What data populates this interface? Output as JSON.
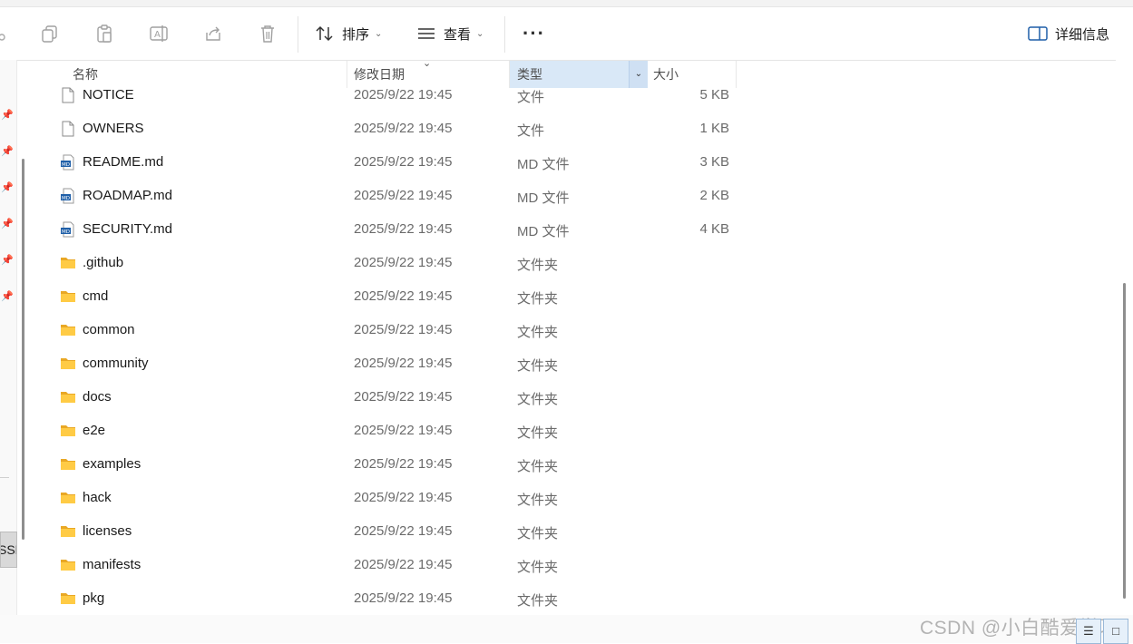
{
  "toolbar": {
    "sort_label": "排序",
    "view_label": "查看",
    "details_label": "详细信息",
    "icons": [
      "copy-icon",
      "paste-icon",
      "rename-icon",
      "share-icon",
      "delete-icon"
    ]
  },
  "columns": {
    "name": "名称",
    "date": "修改日期",
    "type": "类型",
    "size": "大小"
  },
  "left_tab": "SSD",
  "files": [
    {
      "name": "NOTICE",
      "date": "2025/9/22 19:45",
      "type": "文件",
      "size": "5 KB",
      "icon": "file-icon"
    },
    {
      "name": "OWNERS",
      "date": "2025/9/22 19:45",
      "type": "文件",
      "size": "1 KB",
      "icon": "file-icon"
    },
    {
      "name": "README.md",
      "date": "2025/9/22 19:45",
      "type": "MD 文件",
      "size": "3 KB",
      "icon": "md-file-icon"
    },
    {
      "name": "ROADMAP.md",
      "date": "2025/9/22 19:45",
      "type": "MD 文件",
      "size": "2 KB",
      "icon": "md-file-icon"
    },
    {
      "name": "SECURITY.md",
      "date": "2025/9/22 19:45",
      "type": "MD 文件",
      "size": "4 KB",
      "icon": "md-file-icon"
    },
    {
      "name": ".github",
      "date": "2025/9/22 19:45",
      "type": "文件夹",
      "size": "",
      "icon": "folder-icon"
    },
    {
      "name": "cmd",
      "date": "2025/9/22 19:45",
      "type": "文件夹",
      "size": "",
      "icon": "folder-icon"
    },
    {
      "name": "common",
      "date": "2025/9/22 19:45",
      "type": "文件夹",
      "size": "",
      "icon": "folder-icon"
    },
    {
      "name": "community",
      "date": "2025/9/22 19:45",
      "type": "文件夹",
      "size": "",
      "icon": "folder-icon"
    },
    {
      "name": "docs",
      "date": "2025/9/22 19:45",
      "type": "文件夹",
      "size": "",
      "icon": "folder-icon"
    },
    {
      "name": "e2e",
      "date": "2025/9/22 19:45",
      "type": "文件夹",
      "size": "",
      "icon": "folder-icon"
    },
    {
      "name": "examples",
      "date": "2025/9/22 19:45",
      "type": "文件夹",
      "size": "",
      "icon": "folder-icon"
    },
    {
      "name": "hack",
      "date": "2025/9/22 19:45",
      "type": "文件夹",
      "size": "",
      "icon": "folder-icon"
    },
    {
      "name": "licenses",
      "date": "2025/9/22 19:45",
      "type": "文件夹",
      "size": "",
      "icon": "folder-icon"
    },
    {
      "name": "manifests",
      "date": "2025/9/22 19:45",
      "type": "文件夹",
      "size": "",
      "icon": "folder-icon"
    },
    {
      "name": "pkg",
      "date": "2025/9/22 19:45",
      "type": "文件夹",
      "size": "",
      "icon": "folder-icon"
    }
  ],
  "watermark": "CSDN @小白酷爱学习"
}
